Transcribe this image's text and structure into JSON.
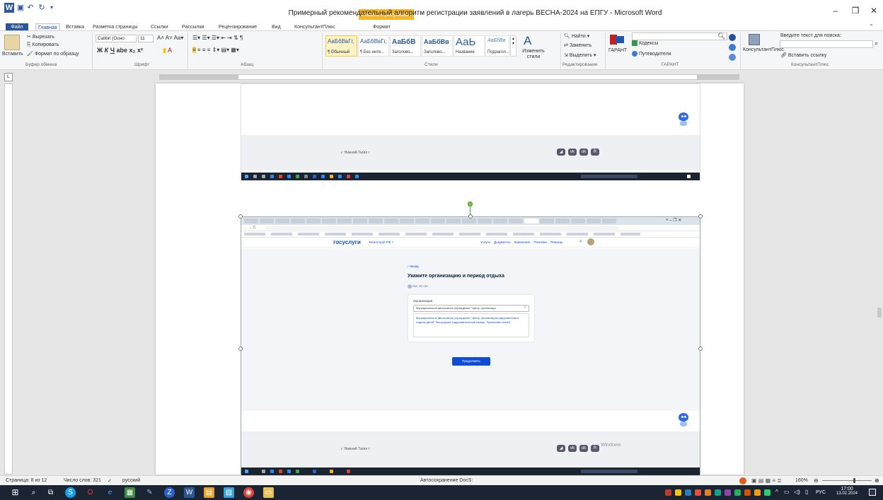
{
  "window": {
    "title": "Примерный рекомендательный алгоритм регистрации заявлений в лагерь ВЕСНА-2024 на ЕПГУ  -  Microsoft Word",
    "context_tab_header": "Работа с рисунками"
  },
  "tabs": [
    {
      "label": "Файл"
    },
    {
      "label": "Главная"
    },
    {
      "label": "Вставка"
    },
    {
      "label": "Разметка страницы"
    },
    {
      "label": "Ссылки"
    },
    {
      "label": "Рассылки"
    },
    {
      "label": "Рецензирование"
    },
    {
      "label": "Вид"
    },
    {
      "label": "КонсультантПлюс"
    },
    {
      "label": "Формат"
    }
  ],
  "ribbon": {
    "clipboard": {
      "paste": "Вставить",
      "cut": "Вырезать",
      "copy": "Копировать",
      "format_painter": "Формат по образцу",
      "group": "Буфер обмена"
    },
    "font": {
      "family": "Calibri (Осно",
      "size": "11",
      "group": "Шрифт"
    },
    "paragraph": {
      "group": "Абзац"
    },
    "styles": {
      "items": [
        {
          "sample": "АаБбВвГг,",
          "name": "¶ Обычный"
        },
        {
          "sample": "АаБбВвГг,",
          "name": "¶ Без инте..."
        },
        {
          "sample": "АаБбВ",
          "name": "Заголово..."
        },
        {
          "sample": "АаБбВв",
          "name": "Заголово..."
        },
        {
          "sample": "АаЬ",
          "name": "Название"
        },
        {
          "sample": "АаБбВв",
          "name": "Подзагол..."
        }
      ],
      "change_styles": "Изменить стили",
      "group": "Стили"
    },
    "editing": {
      "find": "Найти",
      "replace": "Заменить",
      "select": "Выделить",
      "group": "Редактирование"
    },
    "garant": {
      "label": "ГАРАНТ",
      "codexes": "Кодексы",
      "guides": "Путеводители",
      "group": "ГАРАНТ"
    },
    "consultant": {
      "label": "КонсультантПлюс",
      "search_label": "Введите текст для поиска:",
      "insert_link": "Вставить ссылку",
      "group": "КонсультантПлюс"
    }
  },
  "document": {
    "shot1": {
      "footer_city": "Нижний Тагил г"
    },
    "shot2": {
      "logo": "госуслуги",
      "region": "Тагилстрой РФ",
      "nav": [
        "Услуги",
        "Документы",
        "Заявления",
        "Платежи",
        "Помощь"
      ],
      "back": "‹ Назад",
      "heading": "Укажите организацию и период отдыха",
      "child": "Кос 10 лет",
      "org_label": "Организация",
      "org_input": "Муниципальное автономное учреждение \"Центр организаци",
      "org_suggestion": "Муниципальное автономное учреждение \"Центр организации оздоровления и отдыха детей\" Загородный оздоровительный лагерь \"Уральский огонек\"",
      "continue_button": "Продолжить",
      "footer_city": "Нижний Тагил г",
      "windows_watermark": "Windows"
    }
  },
  "statusbar": {
    "page": "Страница: 8 из 12",
    "words": "Число слов: 321",
    "language": "русский",
    "autosave": "Автосохранение DocS:",
    "zoom": "160%"
  },
  "taskbar": {
    "lang": "РУС",
    "time": "17:00",
    "date": "13.02.2024"
  },
  "colors": {
    "word_blue": "#2b579a",
    "gosuslugi_blue": "#0d4cd3",
    "context_tab": "#f5b52a",
    "taskbar": "#1b2433"
  }
}
